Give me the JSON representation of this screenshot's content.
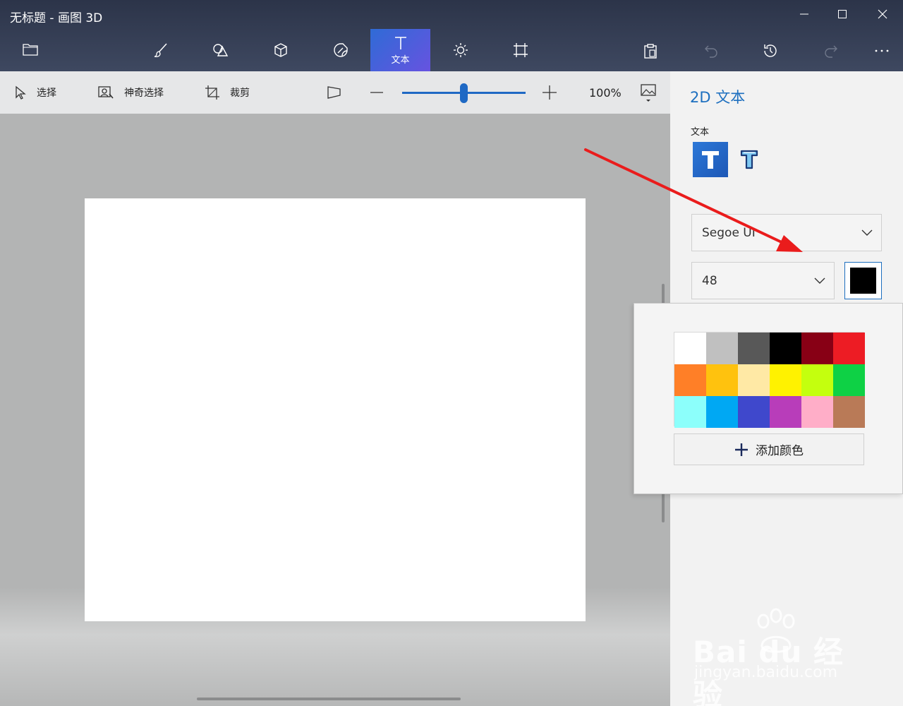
{
  "window": {
    "title": "无标题 - 画图 3D",
    "minimize_icon": "minimize-icon",
    "maximize_icon": "maximize-icon",
    "close_icon": "close-icon"
  },
  "top_toolbar": {
    "menu_icon": "folder-icon",
    "tools": [
      {
        "id": "brushes",
        "icon": "brush-icon"
      },
      {
        "id": "2d-shapes",
        "icon": "shapes-icon"
      },
      {
        "id": "3d-shapes",
        "icon": "cube-icon"
      },
      {
        "id": "stickers",
        "icon": "sticker-icon"
      },
      {
        "id": "text",
        "icon": "text-icon",
        "label": "文本",
        "active": true
      },
      {
        "id": "effects",
        "icon": "sun-icon"
      },
      {
        "id": "canvas",
        "icon": "canvas-icon"
      }
    ],
    "right_icons": [
      "paste-icon",
      "undo-icon",
      "history-icon",
      "redo-icon",
      "more-icon"
    ]
  },
  "sub_toolbar": {
    "select_label": "选择",
    "magic_select_label": "神奇选择",
    "crop_label": "裁剪",
    "zoom_value": "100%",
    "zoom": 100
  },
  "panel": {
    "title": "2D 文本",
    "text_section_label": "文本",
    "font_name": "Segoe UI",
    "font_size": "48",
    "text_color": "#000000"
  },
  "color_popup": {
    "palette": [
      "#ffffff",
      "#c0c0c0",
      "#585858",
      "#000000",
      "#880015",
      "#ed1c24",
      "#ff7f27",
      "#ffc20e",
      "#ffe9a5",
      "#fff200",
      "#c4ff0e",
      "#0ed145",
      "#8cfffb",
      "#00a8f3",
      "#3f48cc",
      "#b83dba",
      "#ffaec8",
      "#b97a57"
    ],
    "add_color_label": "添加颜色"
  },
  "watermark": {
    "brand": "Bai du 经验",
    "url": "jingyan.baidu.com"
  }
}
